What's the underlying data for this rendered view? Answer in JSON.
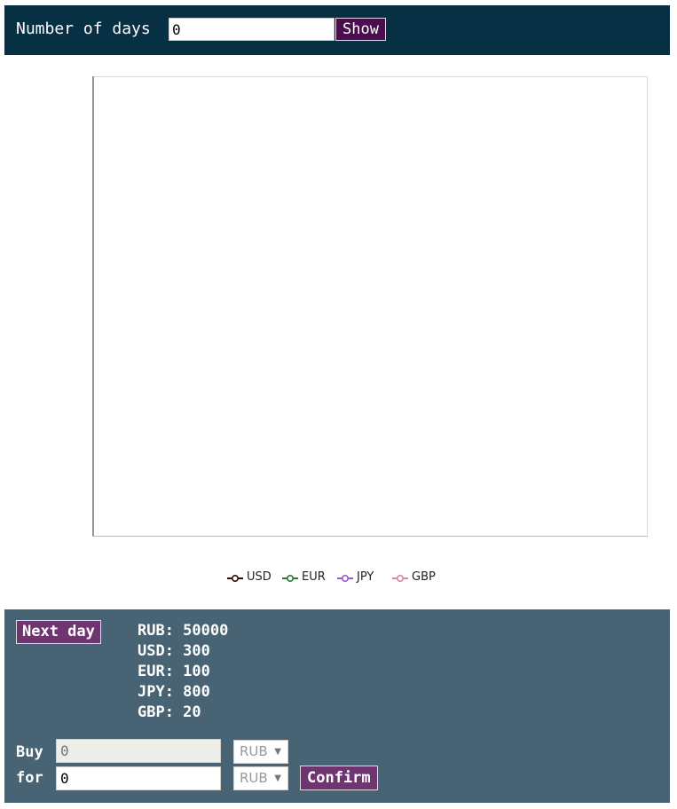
{
  "topbar": {
    "days_label": "Number of days",
    "days_value": "0",
    "show_label": "Show"
  },
  "colors": {
    "topbar_bg": "#083045",
    "panel_bg": "#486373",
    "button_accent": "#6e3570",
    "show_button": "#4a0d4e"
  },
  "chart_data": {
    "type": "line",
    "x": [],
    "series": [
      {
        "name": "USD",
        "values": [],
        "color": "#3a0a0a"
      },
      {
        "name": "EUR",
        "values": [],
        "color": "#2f7a3a"
      },
      {
        "name": "JPY",
        "values": [],
        "color": "#9b59c9"
      },
      {
        "name": "GBP",
        "values": [],
        "color": "#d48aa3"
      }
    ],
    "legend": "bottom-center",
    "grid": false
  },
  "panel": {
    "next_day_label": "Next day",
    "balances": [
      {
        "currency": "RUB",
        "amount": "50000",
        "text": "RUB: 50000"
      },
      {
        "currency": "USD",
        "amount": "300",
        "text": "USD: 300"
      },
      {
        "currency": "EUR",
        "amount": "100",
        "text": "EUR: 100"
      },
      {
        "currency": "JPY",
        "amount": "800",
        "text": "JPY: 800"
      },
      {
        "currency": "GBP",
        "amount": "20",
        "text": "GBP: 20"
      }
    ],
    "buy_label": "Buy",
    "for_label": "for",
    "buy_amount": "0",
    "for_amount": "0",
    "buy_currency": "RUB",
    "for_currency": "RUB",
    "confirm_label": "Confirm"
  }
}
